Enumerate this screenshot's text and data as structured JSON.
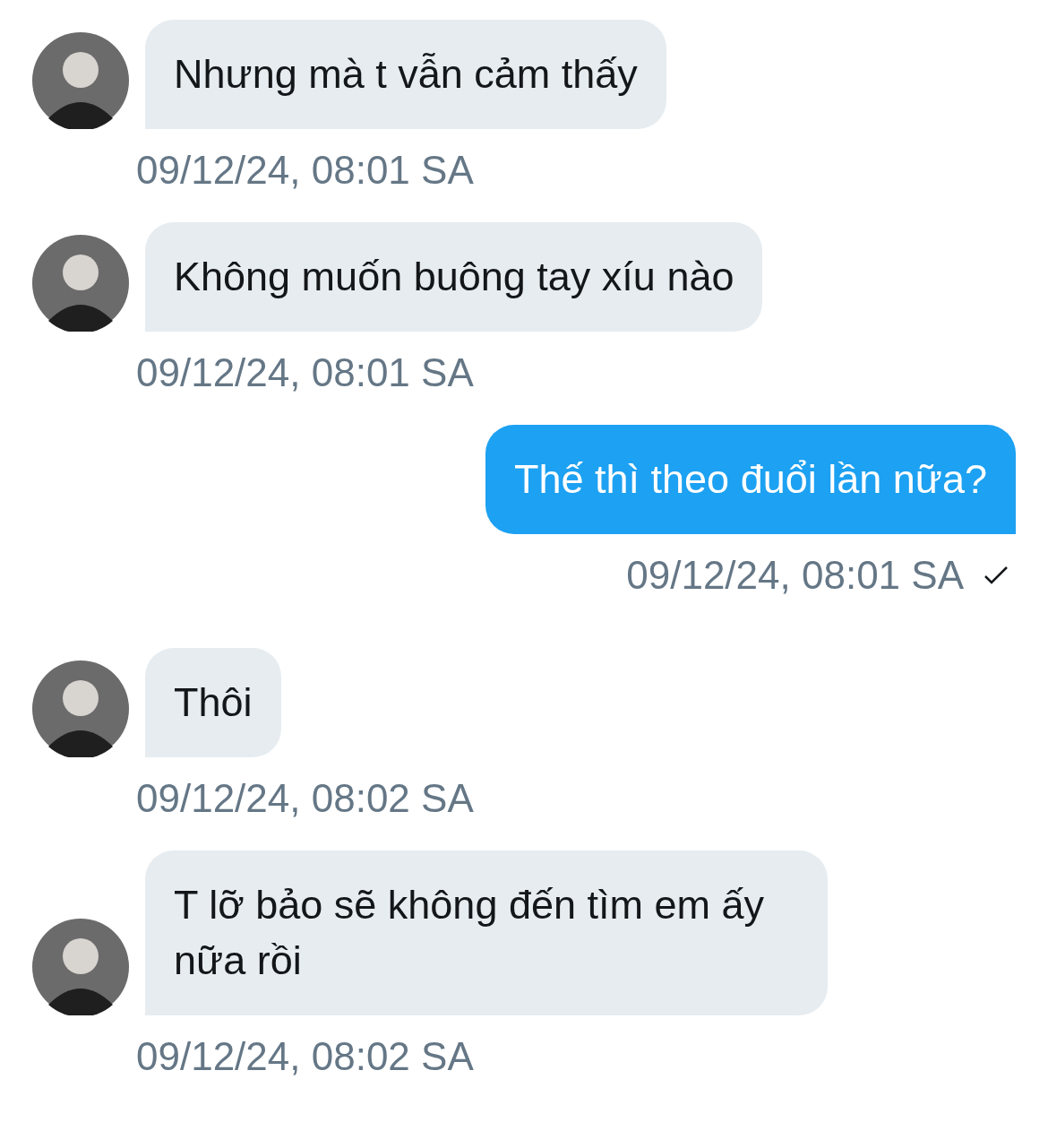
{
  "messages": [
    {
      "kind": "incoming",
      "text": "Nhưng mà t vẫn cảm thấy",
      "time": "09/12/24, 08:01 SA"
    },
    {
      "kind": "incoming",
      "text": "Không muốn buông tay xíu nào",
      "time": "09/12/24, 08:01 SA"
    },
    {
      "kind": "outgoing",
      "text": "Thế thì theo đuổi lần nữa?",
      "time": "09/12/24, 08:01 SA",
      "delivered": true
    },
    {
      "kind": "incoming",
      "text": "Thôi",
      "time": "09/12/24, 08:02 SA"
    },
    {
      "kind": "incoming",
      "text": "T lỡ bảo sẽ không đến tìm em ấy nữa rồi",
      "time": "09/12/24, 08:02 SA"
    }
  ]
}
